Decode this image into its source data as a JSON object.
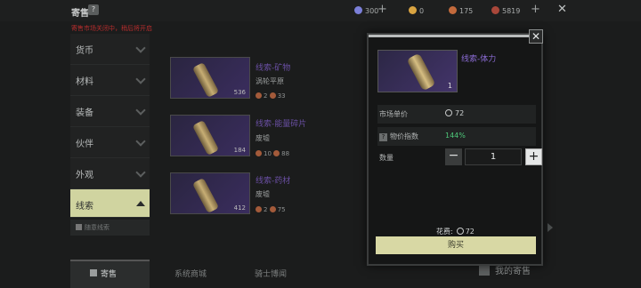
{
  "header": {
    "title": "寄售",
    "help": "?",
    "currencies": [
      {
        "value": "300",
        "icon": "gem-icon",
        "color": "#7b7fd8"
      },
      {
        "value": "0",
        "icon": "gold-coin-icon",
        "color": "#d9a441"
      },
      {
        "value": "175",
        "icon": "silver-coin-icon",
        "color": "#c36a3c"
      },
      {
        "value": "5819",
        "icon": "copper-coin-icon",
        "color": "#a9473a"
      }
    ]
  },
  "warning": "寄售市场关闭中，稍后将开启",
  "sidebar": {
    "items": [
      {
        "label": "货币"
      },
      {
        "label": "材料"
      },
      {
        "label": "装备"
      },
      {
        "label": "伙伴"
      },
      {
        "label": "外观"
      },
      {
        "label": "线索"
      }
    ],
    "sub_item": "随意线索"
  },
  "listings": [
    {
      "name": "线索-矿物",
      "source": "涡轮平原",
      "qty": "536",
      "price_a": "2",
      "price_b": "33"
    },
    {
      "name": "线索-能量碎片",
      "source": "废墟",
      "qty": "184",
      "price_a": "10",
      "price_b": "88"
    },
    {
      "name": "线索-药材",
      "source": "废墟",
      "qty": "412",
      "price_a": "2",
      "price_b": "75"
    }
  ],
  "tabs": [
    "寄售",
    "系统商城",
    "骑士博闻"
  ],
  "my_sale": "我的寄售",
  "dialog": {
    "close": "✕",
    "item_name": "线索-体力",
    "item_qty": "1",
    "market_price_label": "市场单价",
    "market_price": "72",
    "price_index_label": "物价指数",
    "price_index_help": "?",
    "price_index": "144%",
    "quantity_label": "数量",
    "quantity": "1",
    "minus": "−",
    "plus": "+",
    "cost_label": "花费:",
    "cost": "72",
    "buy_label": "购买"
  }
}
